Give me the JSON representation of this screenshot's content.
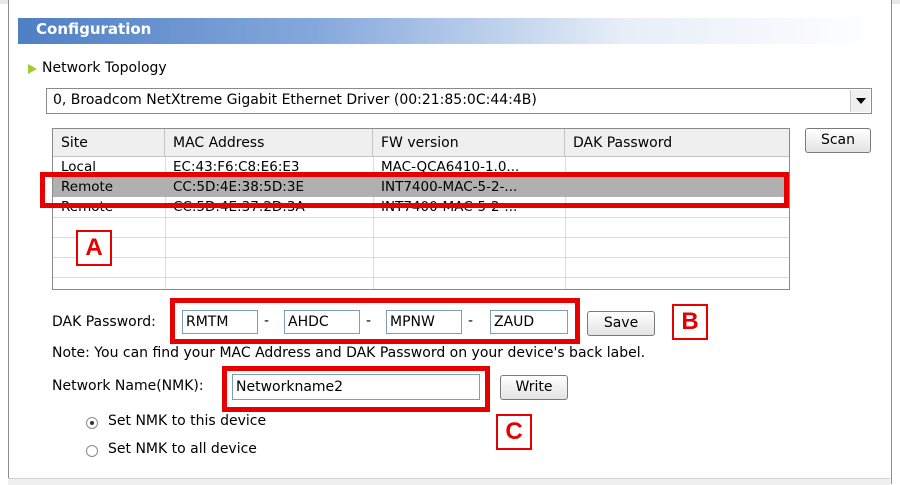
{
  "title": "Configuration",
  "section": "Network Topology",
  "adapter": "0,  Broadcom NetXtreme Gigabit Ethernet Driver  (00:21:85:0C:44:4B)",
  "scan_label": "Scan",
  "table": {
    "headers": [
      "Site",
      "MAC Address",
      "FW version",
      "DAK Password"
    ],
    "rows": [
      {
        "site": "Local",
        "mac": "EC:43:F6:C8:E6:E3",
        "fw": "MAC-QCA6410-1.0..."
      },
      {
        "site": "Remote",
        "mac": "CC:5D:4E:38:5D:3E",
        "fw": "INT7400-MAC-5-2-..."
      },
      {
        "site": "Remote",
        "mac": "CC:5D:4E:37:2D:3A",
        "fw": "INT7400-MAC-5-2-..."
      }
    ],
    "selected_row": 1
  },
  "dak": {
    "label": "DAK Password:",
    "parts": [
      "RMTM",
      "AHDC",
      "MPNW",
      "ZAUD"
    ],
    "separator": "-",
    "save_label": "Save"
  },
  "note": "Note: You can find your MAC Address and DAK Password on your device's back label.",
  "nmk": {
    "label": "Network Name(NMK):",
    "value": "Networkname2",
    "write_label": "Write"
  },
  "options": [
    {
      "label": "Set NMK to this device",
      "checked": true
    },
    {
      "label": "Set NMK to all device",
      "checked": false
    }
  ],
  "callouts": [
    "A",
    "B",
    "C"
  ],
  "colors": {
    "highlight": "#e60000",
    "selected_row": "#b0b0b0",
    "title_bar": "#4f7fc4"
  }
}
